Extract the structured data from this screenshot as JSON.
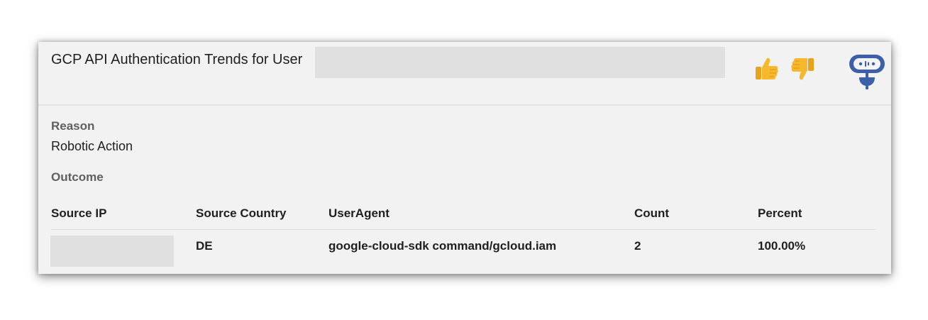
{
  "header": {
    "title": "GCP API Authentication Trends for User"
  },
  "icons": {
    "thumbs_up": "thumbs-up-icon",
    "thumbs_down": "thumbs-down-icon",
    "assistant": "robot-assistant-icon"
  },
  "colors": {
    "thumb": "#f6b92b",
    "assistant": "#3b5fa8",
    "card_bg": "#f2f2f2"
  },
  "reason": {
    "label": "Reason",
    "value": "Robotic Action"
  },
  "outcome": {
    "label": "Outcome"
  },
  "table": {
    "columns": [
      "Source IP",
      "Source Country",
      "UserAgent",
      "Count",
      "Percent"
    ],
    "rows": [
      {
        "source_country": "DE",
        "user_agent": "google-cloud-sdk command/gcloud.iam",
        "count": "2",
        "percent": "100.00%"
      }
    ]
  }
}
